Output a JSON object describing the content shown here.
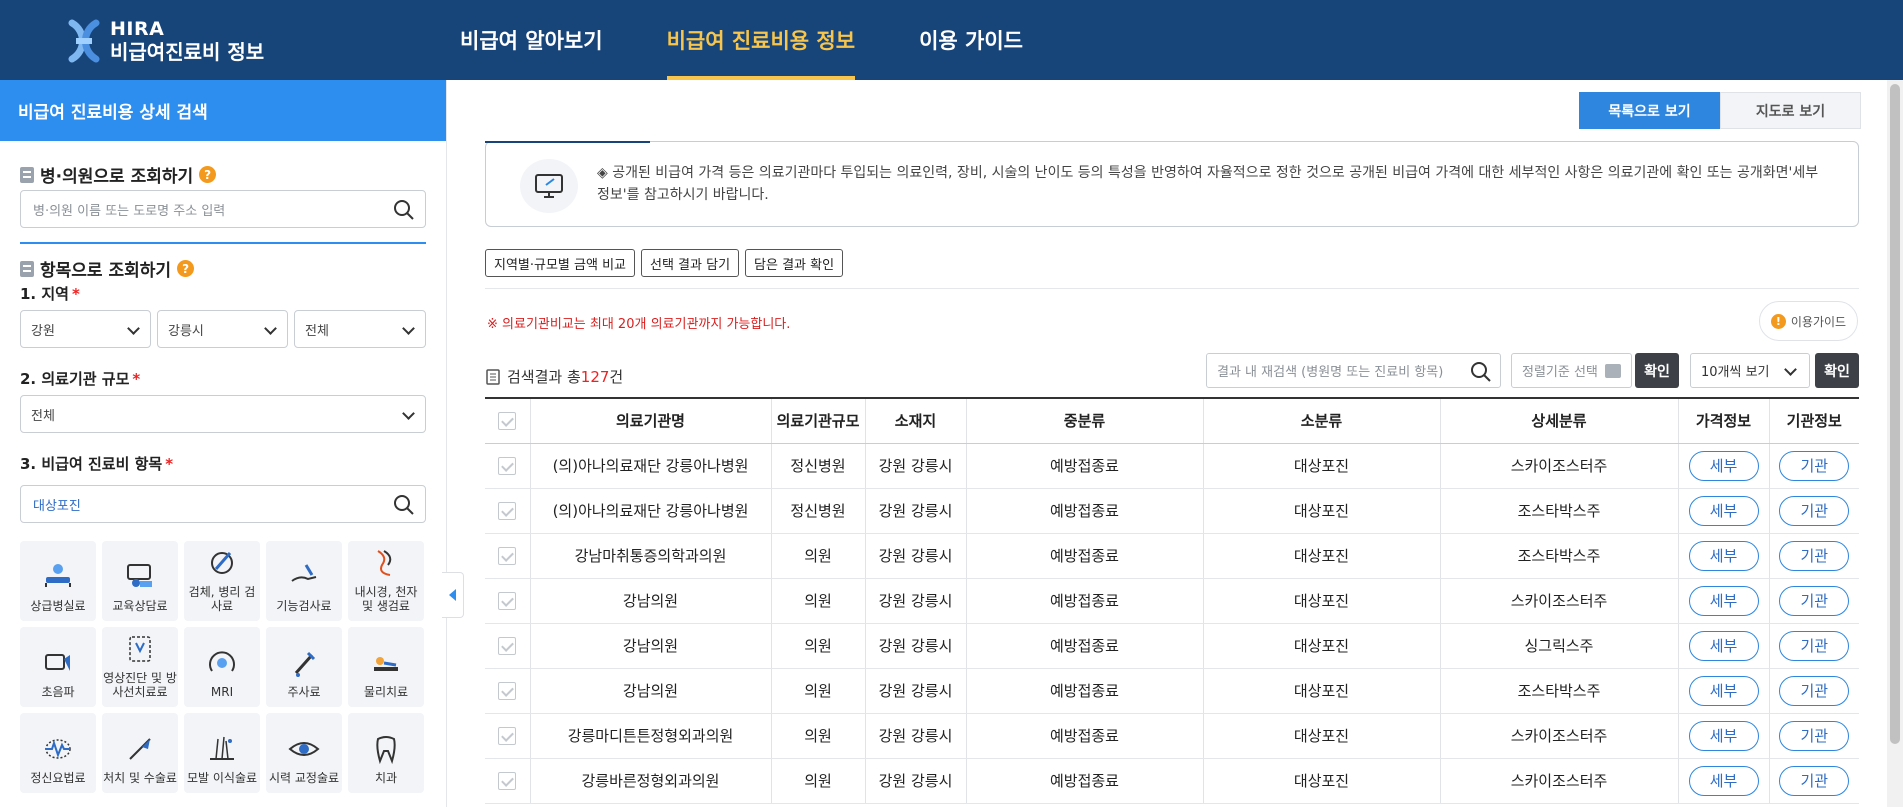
{
  "logo": {
    "line1": "HIRA",
    "line2": "비급여진료비 정보"
  },
  "nav": [
    "비급여 알아보기",
    "비급여 진료비용 정보",
    "이용 가이드"
  ],
  "sidebar": {
    "title": "비급여 진료비용 상세 검색",
    "hospital_section": "병·의원으로 조회하기",
    "hospital_placeholder": "병·의원 이름 또는 도로명 주소 입력",
    "item_section": "항목으로 조회하기",
    "region_label": "1. 지역",
    "region": [
      "강원",
      "강릉시",
      "전체"
    ],
    "scale_label": "2. 의료기관 규모",
    "scale": "전체",
    "item_label": "3. 비급여 진료비 항목",
    "item_value": "대상포진",
    "required": "*",
    "categories": [
      {
        "label": "상급병실료",
        "icon": "bed-icon"
      },
      {
        "label": "교육상담료",
        "icon": "consult-icon"
      },
      {
        "label": "검체, 병리 검사료",
        "icon": "microscope-icon"
      },
      {
        "label": "기능검사료",
        "icon": "hand-test-icon"
      },
      {
        "label": "내시경, 천자 및 생검료",
        "icon": "endoscope-icon"
      },
      {
        "label": "초음파",
        "icon": "ultrasound-icon"
      },
      {
        "label": "영상진단 및 방사선치료료",
        "icon": "xray-icon"
      },
      {
        "label": "MRI",
        "icon": "mri-icon"
      },
      {
        "label": "주사료",
        "icon": "syringe-icon"
      },
      {
        "label": "물리치료",
        "icon": "therapy-icon"
      },
      {
        "label": "정신요법료",
        "icon": "brain-icon"
      },
      {
        "label": "처치 및 수술료",
        "icon": "scalpel-icon"
      },
      {
        "label": "모발 이식술료",
        "icon": "hair-icon"
      },
      {
        "label": "시력 교정술료",
        "icon": "eye-icon"
      },
      {
        "label": "치과",
        "icon": "tooth-icon"
      }
    ]
  },
  "main": {
    "view_list": "목록으로 보기",
    "view_map": "지도로 보기",
    "notice": "◈ 공개된 비급여 가격 등은 의료기관마다 투입되는 의료인력, 장비, 시술의 난이도 등의 특성을 반영하여 자율적으로 정한 것으로 공개된 비급여 가격에 대한 세부적인 사항은 의료기관에 확인 또는 공개화면'세부정보'를 참고하시기 바랍니다.",
    "actions": [
      "지역별·규모별 금액 비교",
      "선택 결과 담기",
      "담은 결과 확인"
    ],
    "warning": "※ 의료기관비교는 최대 20개 의료기관까지 가능합니다.",
    "guide": "이용가이드",
    "result_prefix": "검색결과 총",
    "result_count": "127",
    "result_suffix": "건",
    "research_placeholder": "결과 내 재검색 (병원명 또는 진료비 항목)",
    "sort_placeholder": "정렬기준 선택",
    "confirm": "확인",
    "per_page": "10개씩 보기"
  },
  "table": {
    "headers": [
      "의료기관명",
      "의료기관규모",
      "소재지",
      "중분류",
      "소분류",
      "상세분류",
      "가격정보",
      "기관정보"
    ],
    "detail_btn": "세부",
    "org_btn": "기관",
    "rows": [
      [
        "(의)아나의료재단 강릉아나병원",
        "정신병원",
        "강원 강릉시",
        "예방접종료",
        "대상포진",
        "스카이조스터주"
      ],
      [
        "(의)아나의료재단 강릉아나병원",
        "정신병원",
        "강원 강릉시",
        "예방접종료",
        "대상포진",
        "조스타박스주"
      ],
      [
        "강남마취통증의학과의원",
        "의원",
        "강원 강릉시",
        "예방접종료",
        "대상포진",
        "조스타박스주"
      ],
      [
        "강남의원",
        "의원",
        "강원 강릉시",
        "예방접종료",
        "대상포진",
        "스카이조스터주"
      ],
      [
        "강남의원",
        "의원",
        "강원 강릉시",
        "예방접종료",
        "대상포진",
        "싱그릭스주"
      ],
      [
        "강남의원",
        "의원",
        "강원 강릉시",
        "예방접종료",
        "대상포진",
        "조스타박스주"
      ],
      [
        "강릉마디튼튼정형외과의원",
        "의원",
        "강원 강릉시",
        "예방접종료",
        "대상포진",
        "스카이조스터주"
      ],
      [
        "강릉바른정형외과의원",
        "의원",
        "강원 강릉시",
        "예방접종료",
        "대상포진",
        "스카이조스터주"
      ]
    ]
  }
}
